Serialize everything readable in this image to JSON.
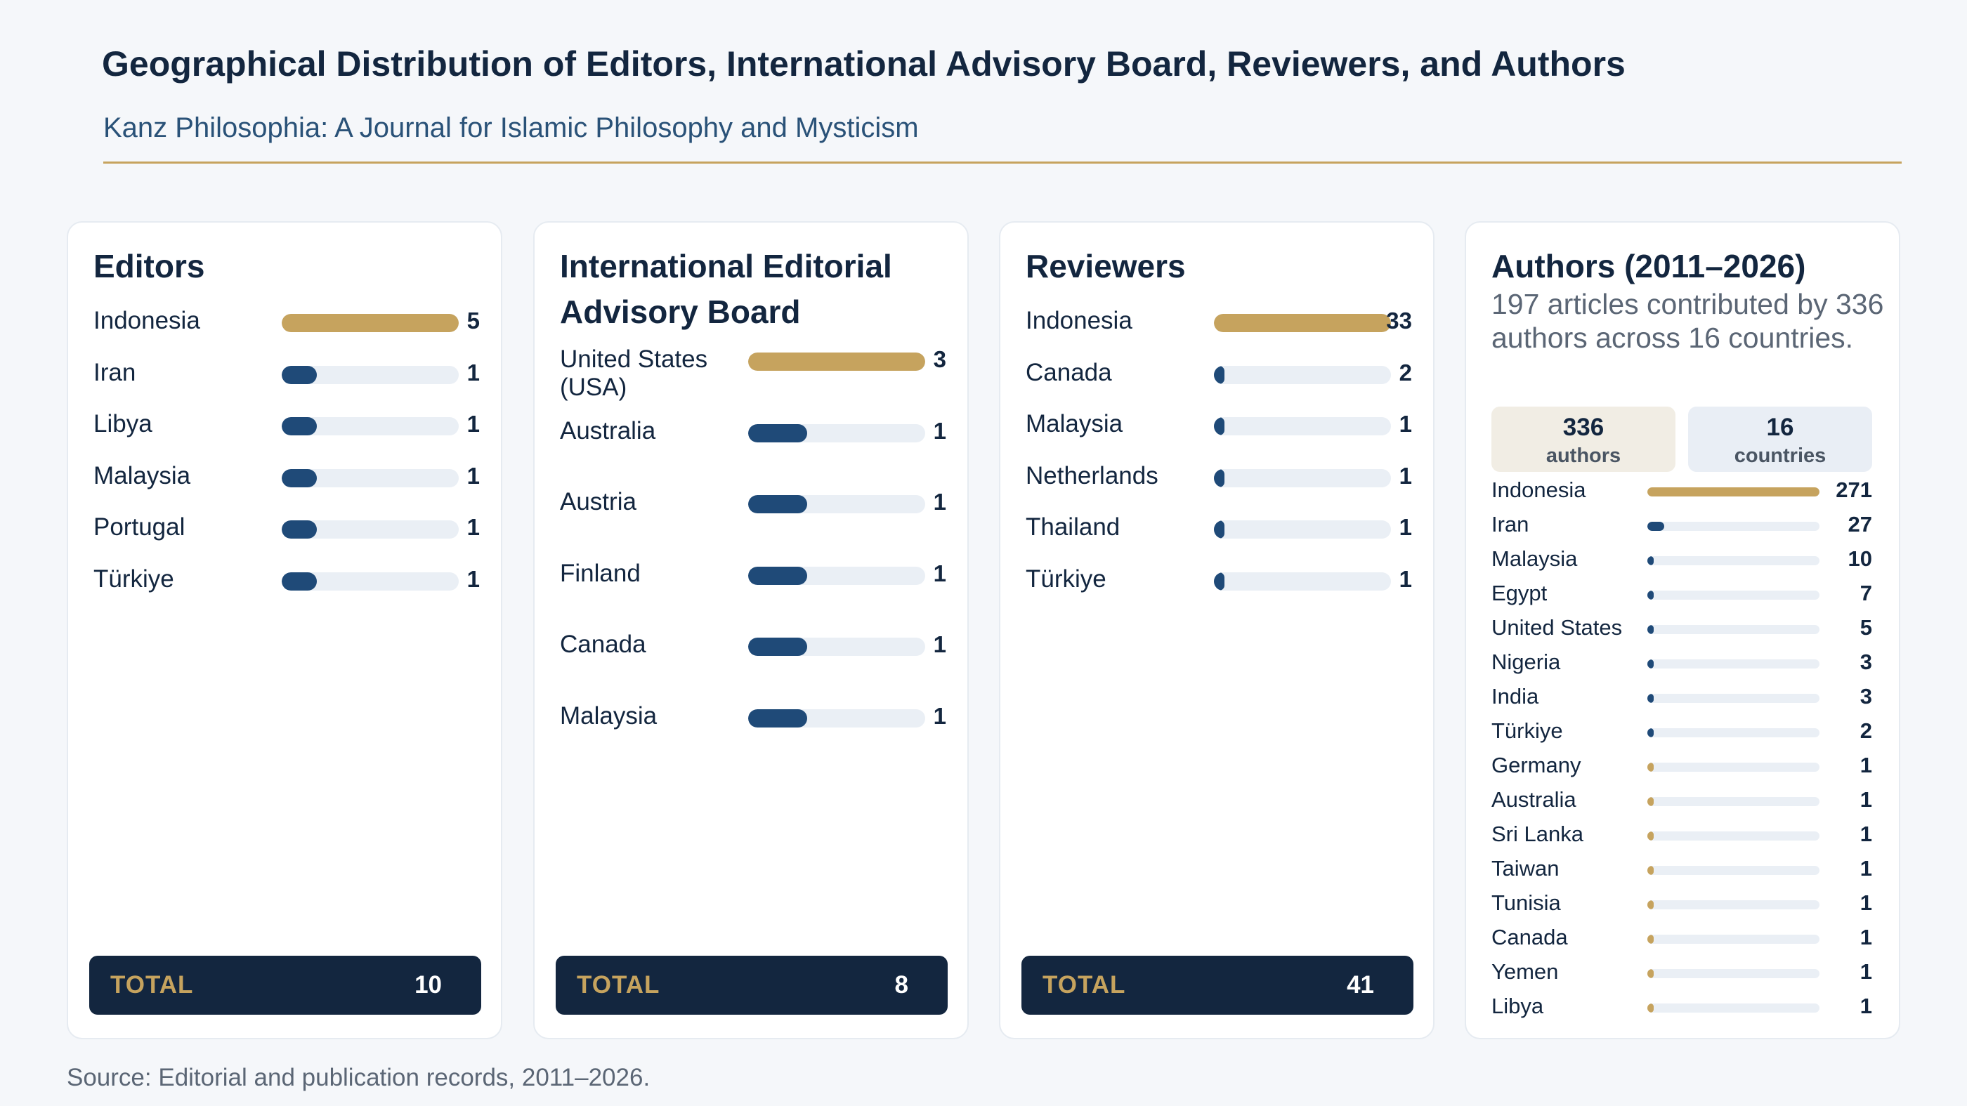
{
  "header": {
    "title": "Geographical Distribution of Editors, International Advisory Board, Reviewers, and Authors",
    "subtitle": "Kanz Philosophia: A Journal for Islamic Philosophy and Mysticism"
  },
  "colors": {
    "accent": "#c6a35e",
    "primary": "#1f4a78",
    "dark": "#13263f",
    "track": "#eaeff5"
  },
  "chart_data": [
    {
      "type": "bar",
      "title": "Editors",
      "categories": [
        "Indonesia",
        "Iran",
        "Libya",
        "Malaysia",
        "Portugal",
        "Türkiye"
      ],
      "values": [
        5,
        1,
        1,
        1,
        1,
        1
      ],
      "xlim": [
        0,
        5
      ],
      "total_label": "TOTAL",
      "total": 10
    },
    {
      "type": "bar",
      "title": "International Editorial Advisory Board",
      "categories": [
        "United States (USA)",
        "Australia",
        "Austria",
        "Finland",
        "Canada",
        "Malaysia"
      ],
      "values": [
        3,
        1,
        1,
        1,
        1,
        1
      ],
      "xlim": [
        0,
        3
      ],
      "total_label": "TOTAL",
      "total": 8
    },
    {
      "type": "bar",
      "title": "Reviewers",
      "categories": [
        "Indonesia",
        "Canada",
        "Malaysia",
        "Netherlands",
        "Thailand",
        "Türkiye"
      ],
      "values": [
        33,
        2,
        1,
        1,
        1,
        1
      ],
      "xlim": [
        0,
        33
      ],
      "total_label": "TOTAL",
      "total": 41
    },
    {
      "type": "bar",
      "title": "Authors (2011–2026)",
      "description": "197 articles contributed by 336 authors across 16 countries.",
      "stats": [
        {
          "value": "336",
          "unit": "authors"
        },
        {
          "value": "16",
          "unit": "countries"
        }
      ],
      "categories": [
        "Indonesia",
        "Iran",
        "Malaysia",
        "Egypt",
        "United States",
        "Nigeria",
        "India",
        "Türkiye",
        "Germany",
        "Australia",
        "Sri Lanka",
        "Taiwan",
        "Tunisia",
        "Canada",
        "Yemen",
        "Libya"
      ],
      "values": [
        271,
        27,
        10,
        7,
        5,
        3,
        3,
        2,
        1,
        1,
        1,
        1,
        1,
        1,
        1,
        1
      ],
      "xlim": [
        0,
        271
      ]
    }
  ],
  "footer": {
    "source": "Source: Editorial and publication records, 2011–2026."
  }
}
